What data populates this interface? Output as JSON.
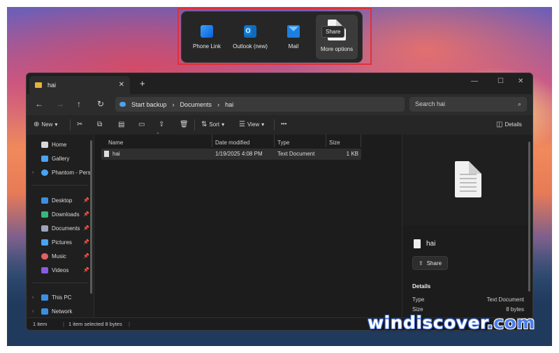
{
  "share_flyout": {
    "apps": [
      {
        "label": "Phone Link",
        "icon": "phone-link-icon"
      },
      {
        "label": "Outlook (new)",
        "icon": "outlook-icon"
      },
      {
        "label": "Mail",
        "icon": "mail-icon"
      },
      {
        "label": "More options",
        "icon": "document-icon"
      }
    ],
    "tooltip": "Share",
    "highlight_color": "#e0303a"
  },
  "window": {
    "tab_title": "hai",
    "breadcrumbs": [
      "Start backup",
      "Documents",
      "hai"
    ],
    "search_placeholder": "Search hai",
    "toolbar": {
      "new_label": "New",
      "sort_label": "Sort",
      "view_label": "View",
      "more_label": "•••",
      "details_label": "Details"
    },
    "nav": {
      "top": [
        "Home",
        "Gallery",
        "Phantom - Perso"
      ],
      "pinned": [
        "Desktop",
        "Downloads",
        "Documents",
        "Pictures",
        "Music",
        "Videos"
      ],
      "bottom": [
        "This PC",
        "Network"
      ]
    },
    "columns": [
      "Name",
      "Date modified",
      "Type",
      "Size"
    ],
    "files": [
      {
        "name": "hai",
        "date": "1/19/2025 4:08 PM",
        "type": "Text Document",
        "size": "1 KB"
      }
    ],
    "preview": {
      "name": "hai",
      "share_label": "Share",
      "details_heading": "Details",
      "details": [
        {
          "key": "Type",
          "value": "Text Document"
        },
        {
          "key": "Size",
          "value": "8 bytes"
        }
      ]
    },
    "status": {
      "items": "1 item",
      "selected": "1 item selected  8 bytes"
    }
  },
  "watermark": {
    "main": "windiscover",
    "accent": ".com"
  }
}
